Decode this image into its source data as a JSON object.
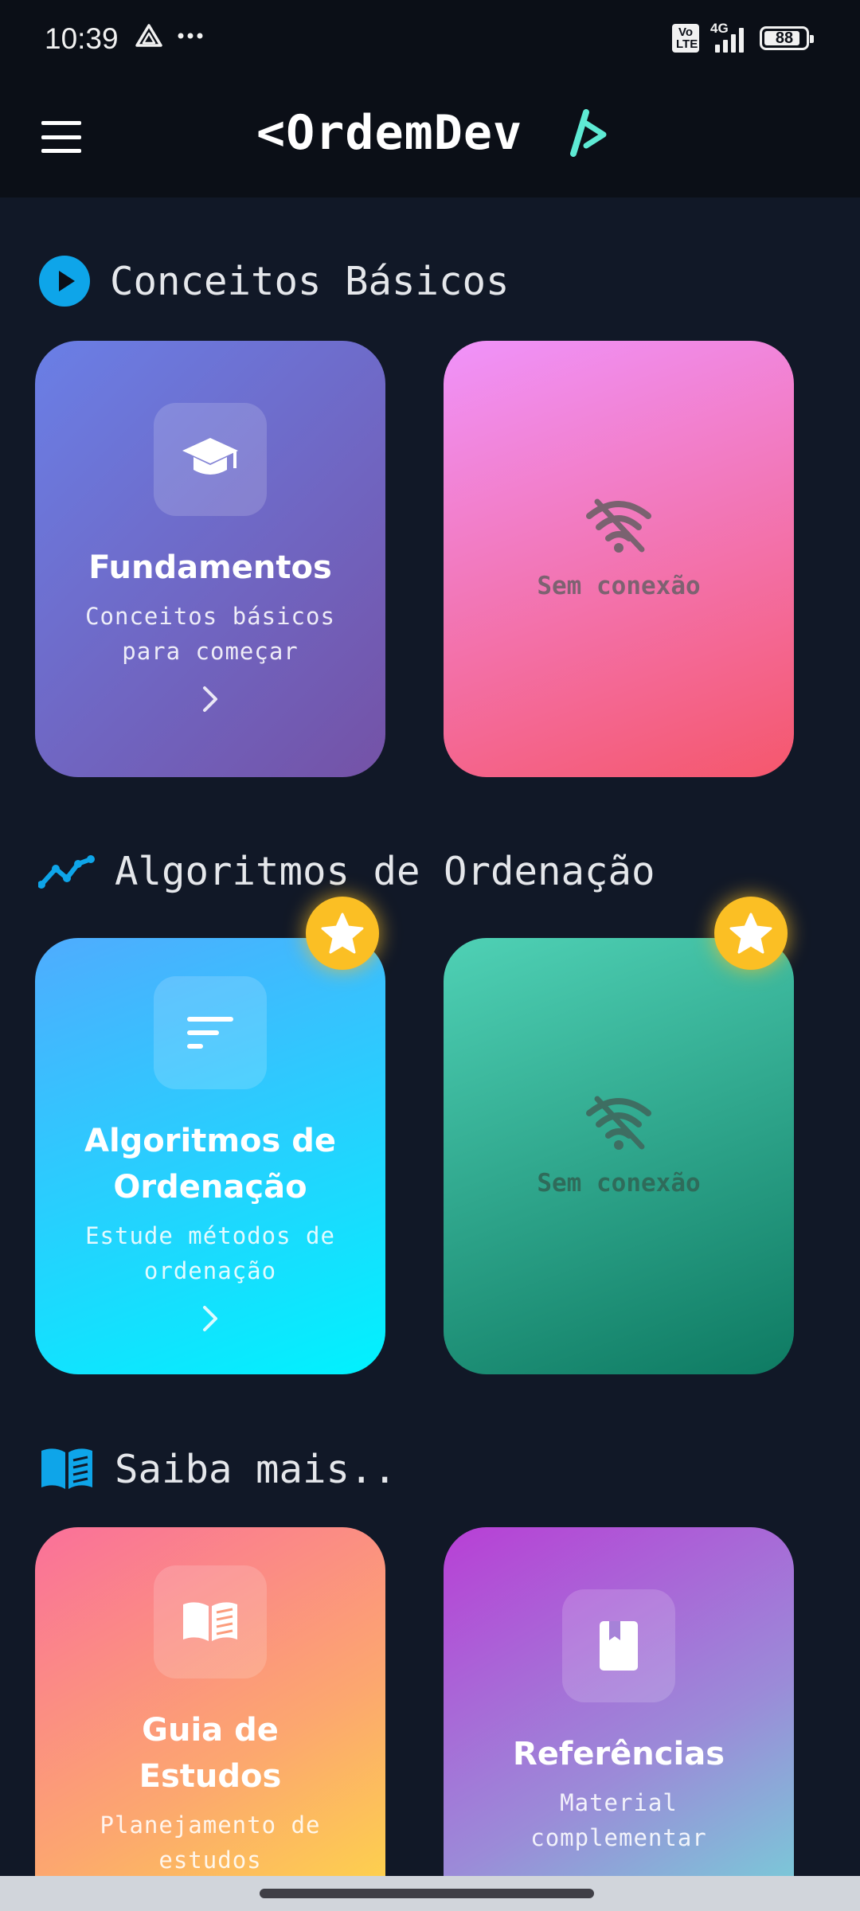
{
  "status": {
    "time": "10:39",
    "volte": "Vo LTE",
    "network": "4G",
    "battery": "88",
    "battery_level": 0.88
  },
  "app": {
    "logo_text": "<OrdemDev",
    "logo_accent_color": "#5eead4"
  },
  "sections": [
    {
      "title": "Conceitos Básicos",
      "icon": "play-circle-icon",
      "cards": [
        {
          "title": "Fundamentos",
          "subtitle": "Conceitos básicos para começar",
          "icon": "graduation-cap-icon",
          "gradient": [
            "#6a7fe6",
            "#7452a6"
          ]
        },
        {
          "offline_label": "Sem conexão",
          "icon": "wifi-off-icon",
          "gradient": [
            "#f093fb",
            "#f5576c"
          ]
        }
      ]
    },
    {
      "title": "Algoritmos de Ordenação",
      "icon": "trend-line-icon",
      "cards": [
        {
          "title": "Algoritmos de Ordenação",
          "subtitle": "Estude métodos de ordenação",
          "icon": "sort-icon",
          "gradient": [
            "#4facfe",
            "#00f2fe"
          ],
          "starred": true
        },
        {
          "offline_label": "Sem conexão",
          "icon": "wifi-off-icon",
          "gradient": [
            "#4fd1b5",
            "#0e7a62"
          ],
          "starred": true
        }
      ]
    },
    {
      "title": "Saiba mais..",
      "icon": "open-book-icon",
      "cards": [
        {
          "title": "Guia de Estudos",
          "subtitle": "Planejamento de estudos",
          "icon": "book-icon",
          "gradient": [
            "#fa709a",
            "#fee140"
          ]
        },
        {
          "title": "Referências",
          "subtitle": "Material complementar",
          "icon": "bookmark-icon",
          "gradient": [
            "#b83fd6",
            "#6ee0d8"
          ]
        }
      ]
    }
  ],
  "colors": {
    "background": "#111827",
    "appbar": "#0b0f17",
    "section_icon": "#0ea5e9",
    "star": "#fbbf24"
  }
}
